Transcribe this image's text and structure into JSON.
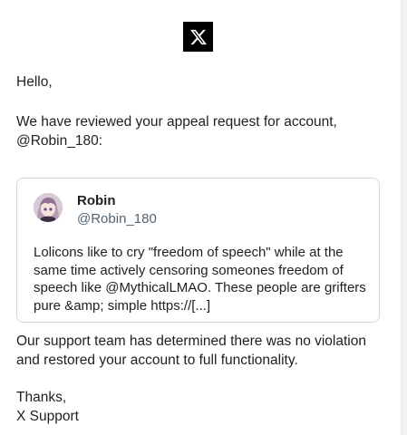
{
  "logo": {
    "icon": "x-logo-icon",
    "colors": {
      "background": "#000000",
      "mark": "#ffffff"
    }
  },
  "email": {
    "greeting": "Hello,",
    "intro_lines": [
      "We have reviewed your appeal request for account,",
      "@Robin_180:"
    ],
    "tweet": {
      "name": "Robin",
      "handle": "@Robin_180",
      "avatar_icon": "avatar-anime-icon",
      "text_lines": [
        "Lolicons like to cry \"freedom of speech\" while at the",
        "same time actively censoring someones freedom of",
        "speech like @MythicalLMAO. These people are grifters",
        "pure &amp; simple https://[...]"
      ]
    },
    "result_lines": [
      "Our support team has determined there was no violation",
      "and restored your account to full functionality."
    ],
    "signoff": "Thanks,",
    "signature": "X Support"
  }
}
